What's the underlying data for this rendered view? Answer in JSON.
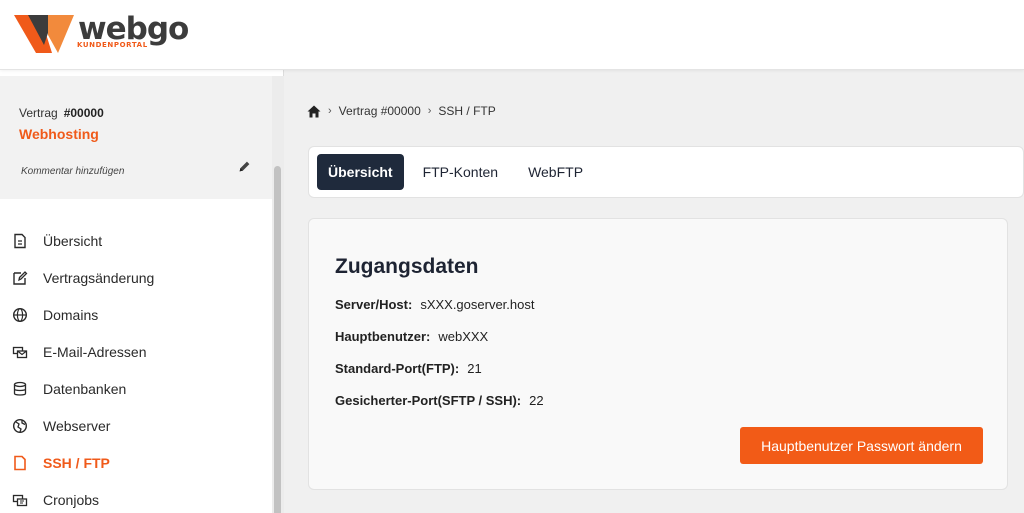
{
  "brand": {
    "name": "webgo",
    "subtitle": "KUNDENPORTAL",
    "colors": {
      "accent": "#f05a1a",
      "dark": "#1f2a3c"
    }
  },
  "contract": {
    "label": "Vertrag",
    "number": "#00000",
    "product": "Webhosting",
    "comment_label": "Kommentar hinzufügen",
    "comment_icon": "pencil-icon"
  },
  "sidebar": {
    "items": [
      {
        "label": "Übersicht",
        "icon": "document-icon",
        "active": false
      },
      {
        "label": "Vertragsänderung",
        "icon": "edit-icon",
        "active": false
      },
      {
        "label": "Domains",
        "icon": "globe-icon",
        "active": false
      },
      {
        "label": "E-Mail-Adressen",
        "icon": "mail-icon",
        "active": false
      },
      {
        "label": "Datenbanken",
        "icon": "database-icon",
        "active": false
      },
      {
        "label": "Webserver",
        "icon": "globe-network-icon",
        "active": false
      },
      {
        "label": "SSH / FTP",
        "icon": "file-icon",
        "active": true
      },
      {
        "label": "Cronjobs",
        "icon": "clock-icon",
        "active": false
      }
    ]
  },
  "breadcrumb": {
    "home_icon": "home-icon",
    "items": [
      "Vertrag #00000",
      "SSH / FTP"
    ]
  },
  "tabs": [
    {
      "label": "Übersicht",
      "active": true
    },
    {
      "label": "FTP-Konten",
      "active": false
    },
    {
      "label": "WebFTP",
      "active": false
    }
  ],
  "access": {
    "title": "Zugangsdaten",
    "fields": [
      {
        "label": "Server/Host:",
        "value": "sXXX.goserver.host"
      },
      {
        "label": "Hauptbenutzer:",
        "value": "webXXX"
      },
      {
        "label": "Standard-Port(FTP):",
        "value": "21"
      },
      {
        "label": "Gesicherter-Port(SFTP / SSH):",
        "value": "22"
      }
    ],
    "button_label": "Hauptbenutzer Passwort ändern"
  }
}
